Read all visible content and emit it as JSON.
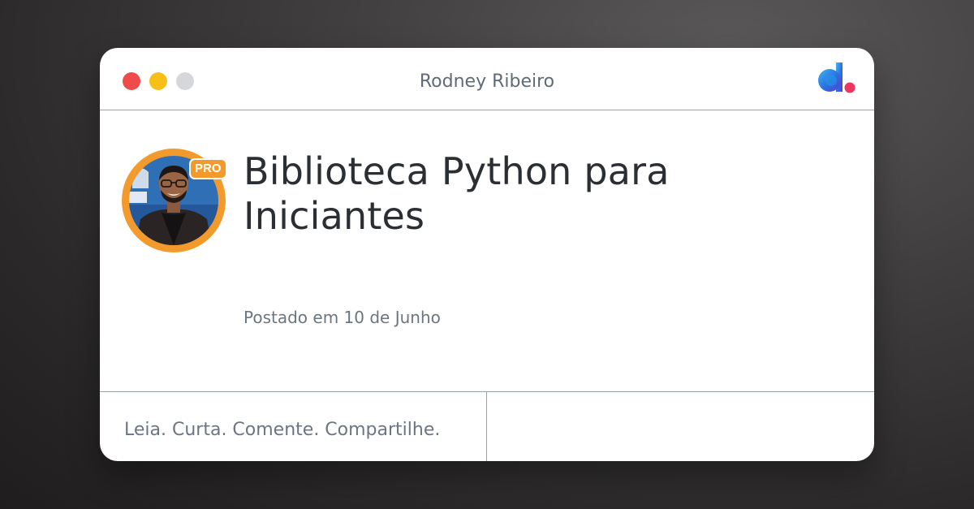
{
  "window": {
    "title": "Rodney Ribeiro",
    "controls": [
      {
        "name": "close",
        "color": "#f04b4b"
      },
      {
        "name": "minimize",
        "color": "#f6c019"
      },
      {
        "name": "maximize",
        "color": "#d5d7da"
      }
    ],
    "brand_icon": "dio-logo-icon"
  },
  "author": {
    "avatar_icon": "author-avatar",
    "badge": "PRO",
    "ring_color": "#f39a2c"
  },
  "post": {
    "title": "Biblioteca Python para Iniciantes",
    "date": "Postado em 10 de Junho"
  },
  "footer": {
    "tagline": "Leia. Curta. Comente. Compartilhe."
  }
}
